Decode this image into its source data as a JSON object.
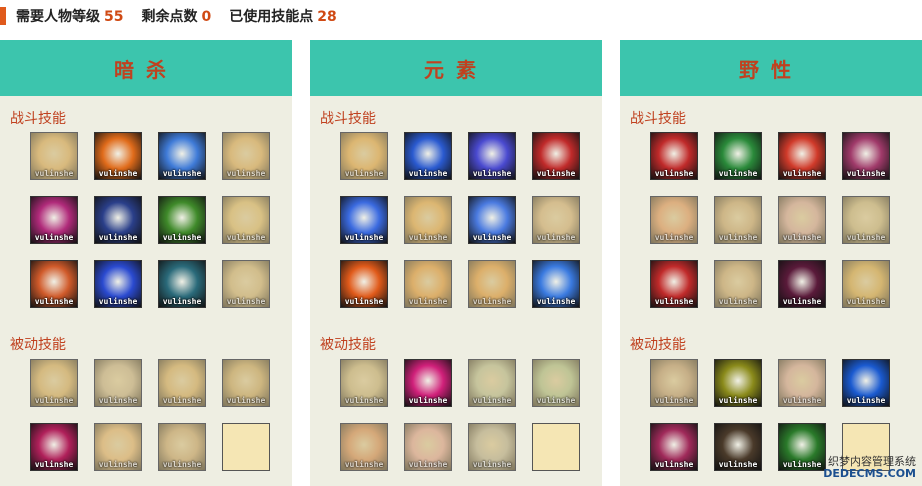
{
  "header": {
    "required_level_label": "需要人物等级",
    "required_level": "55",
    "remaining_points_label": "剩余点数",
    "remaining_points": "0",
    "used_points_label": "已使用技能点",
    "used_points": "28"
  },
  "panels": [
    {
      "title": "暗杀",
      "combat_label": "战斗技能",
      "passive_label": "被动技能",
      "combat": [
        {
          "state": "dim",
          "color": "#d9a85a"
        },
        {
          "state": "active",
          "color": "#e06b1a"
        },
        {
          "state": "active",
          "color": "#3f7bd8"
        },
        {
          "state": "dim",
          "color": "#d9a85a"
        },
        {
          "state": "active",
          "color": "#b02a7a"
        },
        {
          "state": "active",
          "color": "#2a3f8a"
        },
        {
          "state": "active",
          "color": "#3f8a2a"
        },
        {
          "state": "dim",
          "color": "#d9b86a"
        },
        {
          "state": "active",
          "color": "#d05a2a"
        },
        {
          "state": "active",
          "color": "#2a4ad0"
        },
        {
          "state": "active",
          "color": "#2a6a7a"
        },
        {
          "state": "dim",
          "color": "#c9b07a"
        }
      ],
      "passive": [
        {
          "state": "dim",
          "color": "#d0a860"
        },
        {
          "state": "dim",
          "color": "#c0b090"
        },
        {
          "state": "dim",
          "color": "#d0a860"
        },
        {
          "state": "dim",
          "color": "#c0a060"
        },
        {
          "state": "active",
          "color": "#b0205a"
        },
        {
          "state": "dim",
          "color": "#e0b070"
        },
        {
          "state": "dim",
          "color": "#c0a070"
        },
        {
          "state": "empty",
          "color": "#f5e6b4"
        }
      ]
    },
    {
      "title": "元素",
      "combat_label": "战斗技能",
      "passive_label": "被动技能",
      "combat": [
        {
          "state": "dim",
          "color": "#e0a040"
        },
        {
          "state": "active",
          "color": "#2a5ad0"
        },
        {
          "state": "active",
          "color": "#4a4ad0"
        },
        {
          "state": "active",
          "color": "#c02a2a"
        },
        {
          "state": "active",
          "color": "#3a6ae0"
        },
        {
          "state": "dim",
          "color": "#e0a040"
        },
        {
          "state": "active",
          "color": "#4a7ae0"
        },
        {
          "state": "dim",
          "color": "#d0b080"
        },
        {
          "state": "active",
          "color": "#e05a1a"
        },
        {
          "state": "dim",
          "color": "#e09030"
        },
        {
          "state": "dim",
          "color": "#e09030"
        },
        {
          "state": "active",
          "color": "#3a7ae0"
        }
      ],
      "passive": [
        {
          "state": "dim",
          "color": "#c0b080"
        },
        {
          "state": "active",
          "color": "#d0207a"
        },
        {
          "state": "dim",
          "color": "#b0c0a0"
        },
        {
          "state": "dim",
          "color": "#a0c090"
        },
        {
          "state": "dim",
          "color": "#d08050"
        },
        {
          "state": "dim",
          "color": "#e0a0a0"
        },
        {
          "state": "dim",
          "color": "#b0b0a0"
        },
        {
          "state": "empty",
          "color": "#f5e6b4"
        }
      ]
    },
    {
      "title": "野性",
      "combat_label": "战斗技能",
      "passive_label": "被动技能",
      "combat": [
        {
          "state": "active",
          "color": "#c02a2a"
        },
        {
          "state": "active",
          "color": "#2a8a3a"
        },
        {
          "state": "active",
          "color": "#d03a2a"
        },
        {
          "state": "active",
          "color": "#a03a6a"
        },
        {
          "state": "dim",
          "color": "#e09060"
        },
        {
          "state": "dim",
          "color": "#c0a070"
        },
        {
          "state": "dim",
          "color": "#d0a0a0"
        },
        {
          "state": "dim",
          "color": "#c0b080"
        },
        {
          "state": "active",
          "color": "#c02a2a"
        },
        {
          "state": "dim",
          "color": "#c0a070"
        },
        {
          "state": "active",
          "color": "#5a1a3a"
        },
        {
          "state": "dim",
          "color": "#d0a040"
        }
      ],
      "passive": [
        {
          "state": "dim",
          "color": "#b09070"
        },
        {
          "state": "active",
          "color": "#8a8a1a"
        },
        {
          "state": "dim",
          "color": "#d0a0a0"
        },
        {
          "state": "active",
          "color": "#1a5ad0"
        },
        {
          "state": "active",
          "color": "#a02a5a"
        },
        {
          "state": "active",
          "color": "#4a3a2a"
        },
        {
          "state": "active",
          "color": "#2a7a2a"
        },
        {
          "state": "empty",
          "color": "#f5e6b4"
        }
      ]
    }
  ],
  "watermark_text": "vulinshe",
  "corner_watermark": {
    "line1": "织梦内容管理系统",
    "line2": "DEDECMS.COM"
  }
}
